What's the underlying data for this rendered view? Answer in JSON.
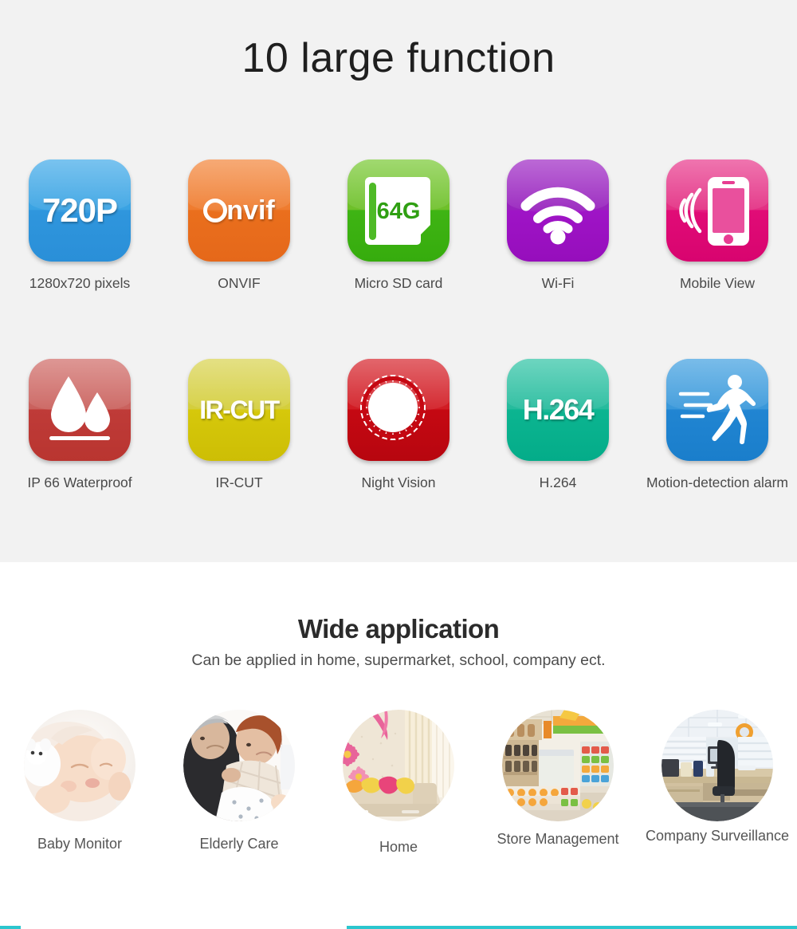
{
  "features": {
    "title": "10 large function",
    "items": [
      {
        "label": "1280x720 pixels",
        "tile_text": "720P",
        "icon": "resolution-720p-icon",
        "theme": "t-720p",
        "color": "#2f96dd"
      },
      {
        "label": "ONVIF",
        "tile_text": "nvif",
        "icon": "onvif-logo-icon",
        "theme": "t-onvif",
        "color": "#ea6f1d"
      },
      {
        "label": "Micro SD card",
        "tile_text": "64G",
        "icon": "micro-sd-card-icon",
        "theme": "t-sd",
        "color": "#3fb414"
      },
      {
        "label": "Wi-Fi",
        "tile_text": "",
        "icon": "wifi-icon",
        "theme": "t-wifi",
        "color": "#9f14c6"
      },
      {
        "label": "Mobile View",
        "tile_text": "",
        "icon": "mobile-phone-icon",
        "theme": "t-mobile",
        "color": "#e10c77"
      },
      {
        "label": "IP 66 Waterproof",
        "tile_text": "",
        "icon": "water-drops-icon",
        "theme": "t-water",
        "color": "#bf3b38"
      },
      {
        "label": "IR-CUT",
        "tile_text": "IR-CUT",
        "icon": "ir-cut-icon",
        "theme": "t-ircut",
        "color": "#d6c80b"
      },
      {
        "label": "Night Vision",
        "tile_text": "",
        "icon": "sun-moon-icon",
        "theme": "t-night",
        "color": "#c50812"
      },
      {
        "label": "H.264",
        "tile_text": "H.264",
        "icon": "h264-codec-icon",
        "theme": "t-h264",
        "color": "#0cb591"
      },
      {
        "label": "Motion-detection alarm",
        "tile_text": "",
        "icon": "running-man-icon",
        "theme": "t-motion",
        "color": "#2185d2"
      }
    ],
    "sd_card_capacity": "64G"
  },
  "application": {
    "title": "Wide application",
    "subtitle": "Can be applied in home, supermarket, school, company ect.",
    "items": [
      {
        "label": "Baby Monitor",
        "photo": "sleeping-baby-photo"
      },
      {
        "label": "Elderly Care",
        "photo": "elderly-couple-photo"
      },
      {
        "label": "Home",
        "photo": "living-room-photo"
      },
      {
        "label": "Store Management",
        "photo": "supermarket-shelves-photo"
      },
      {
        "label": "Company Surveillance",
        "photo": "office-interior-photo"
      }
    ]
  },
  "accent": {
    "teal_rule": "#2cc6ce",
    "section_bg": "#f2f2f2"
  }
}
